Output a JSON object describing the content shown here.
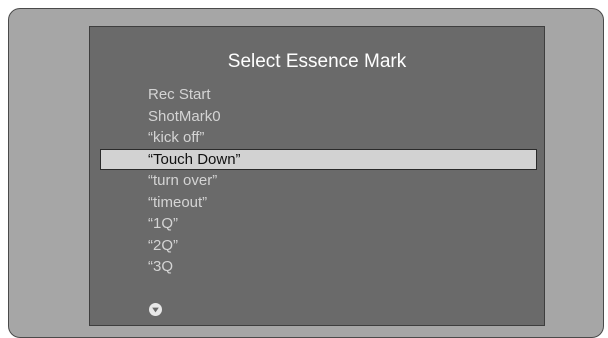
{
  "menu": {
    "title": "Select Essence Mark",
    "items": [
      {
        "label": "Rec Start",
        "selected": false
      },
      {
        "label": "ShotMark0",
        "selected": false
      },
      {
        "label": "“kick off”",
        "selected": false
      },
      {
        "label": "“Touch Down”",
        "selected": true
      },
      {
        "label": "“turn over”",
        "selected": false
      },
      {
        "label": "“timeout”",
        "selected": false
      },
      {
        "label": "“1Q”",
        "selected": false
      },
      {
        "label": "“2Q”",
        "selected": false
      },
      {
        "label": "“3Q",
        "selected": false
      }
    ],
    "scroll_indicator_icon": "circle-chevron-down-icon"
  },
  "colors": {
    "screen_background": "#a6a6a6",
    "panel_background": "#6a6a6a",
    "selection_background": "#d2d2d2",
    "item_text": "#d4d4d4",
    "selected_text": "#111111",
    "title_text": "#ffffff"
  }
}
